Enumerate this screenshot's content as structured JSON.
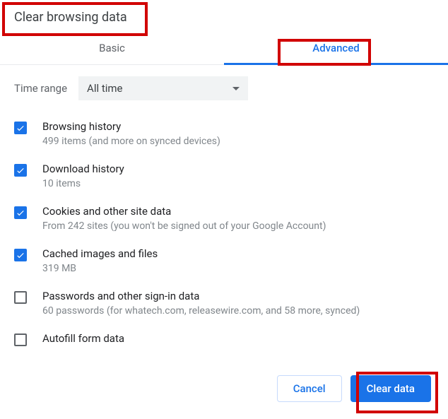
{
  "title": "Clear browsing data",
  "tabs": {
    "basic": "Basic",
    "advanced": "Advanced"
  },
  "timerange": {
    "label": "Time range",
    "selected": "All time"
  },
  "items": [
    {
      "checked": true,
      "title": "Browsing history",
      "desc": "499 items (and more on synced devices)"
    },
    {
      "checked": true,
      "title": "Download history",
      "desc": "10 items"
    },
    {
      "checked": true,
      "title": "Cookies and other site data",
      "desc": "From 242 sites (you won't be signed out of your Google Account)"
    },
    {
      "checked": true,
      "title": "Cached images and files",
      "desc": "319 MB"
    },
    {
      "checked": false,
      "title": "Passwords and other sign-in data",
      "desc": "60 passwords (for whatech.com, releasewire.com, and 58 more, synced)"
    },
    {
      "checked": false,
      "title": "Autofill form data",
      "desc": ""
    }
  ],
  "buttons": {
    "cancel": "Cancel",
    "clear": "Clear data"
  }
}
